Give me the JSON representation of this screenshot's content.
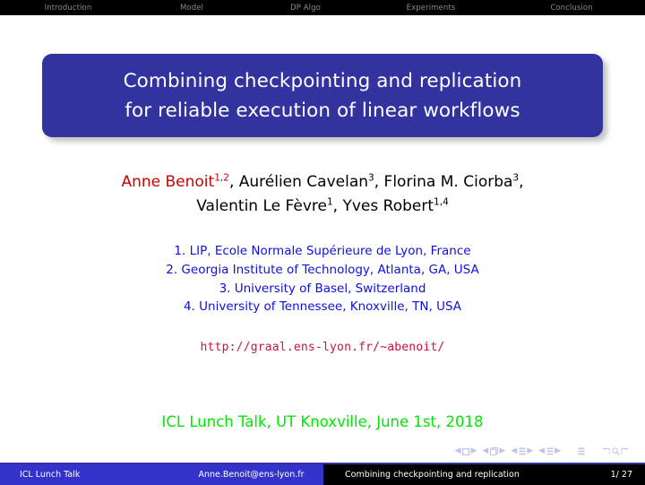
{
  "header": {
    "nav_items": [
      {
        "label": "Introduction"
      },
      {
        "label": "Model"
      },
      {
        "label": "DP Algo"
      },
      {
        "label": "Experiments"
      },
      {
        "label": "Conclusion"
      }
    ],
    "bar_color": "#000000",
    "text_color": "#8a8a8a"
  },
  "title": {
    "line1": "Combining checkpointing and replication",
    "line2": "for reliable execution of linear workflows",
    "box_color": "#3333a0",
    "text_color": "#ffffff"
  },
  "authors": {
    "highlight_color": "#cc0000",
    "line1": {
      "highlight_name": "Anne Benoit",
      "highlight_sup": "1,2",
      "rest_a": ", Aurélien Cavelan",
      "sup_a": "3",
      "rest_b": ", Florina M. Ciorba",
      "sup_b": "3",
      "rest_c": ","
    },
    "line2": {
      "name_a": "Valentin Le Fèvre",
      "sup_a": "1",
      "sep": ", ",
      "name_b": "Yves Robert",
      "sup_b": "1,4"
    }
  },
  "affiliations": {
    "color": "#0f0fdd",
    "items": [
      "1. LIP, Ecole Normale Supérieure de Lyon, France",
      "2. Georgia Institute of Technology, Atlanta, GA, USA",
      "3. University of Basel, Switzerland",
      "4. University of Tennessee, Knoxville, TN, USA"
    ]
  },
  "url": {
    "text": "http://graal.ens-lyon.fr/~abenoit/",
    "color": "#cc1144"
  },
  "event": {
    "text": "ICL Lunch Talk, UT Knoxville, June 1st, 2018",
    "color": "#00e800"
  },
  "nav_symbols": {
    "color": "#c3c3e6",
    "groups": [
      {
        "icon": "beamer-nav-slide-icon"
      },
      {
        "icon": "beamer-nav-frame-icon"
      },
      {
        "icon": "beamer-nav-subsection-icon"
      },
      {
        "icon": "beamer-nav-section-icon"
      },
      {
        "icon": "beamer-nav-presentation-icon"
      },
      {
        "icon": "beamer-nav-back-find-forward-icon"
      }
    ]
  },
  "footer": {
    "left": "ICL Lunch Talk",
    "email": "Anne.Benoit@ens-lyon.fr",
    "short_title": "Combining checkpointing and replication",
    "page": "1/ 27",
    "left_bg": "#3333cc",
    "right_bg": "#000000"
  }
}
